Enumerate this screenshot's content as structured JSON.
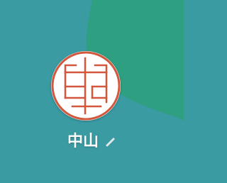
{
  "user": {
    "display_name": "中山"
  },
  "avatar": {
    "icon": "seal-stamp-icon",
    "ring_color": "#d2573d",
    "fill_color": "#ffffff"
  },
  "colors": {
    "background_blue": "#3a9ba3",
    "background_green": "#2f9f82"
  },
  "edit": {
    "icon": "pencil-icon"
  }
}
